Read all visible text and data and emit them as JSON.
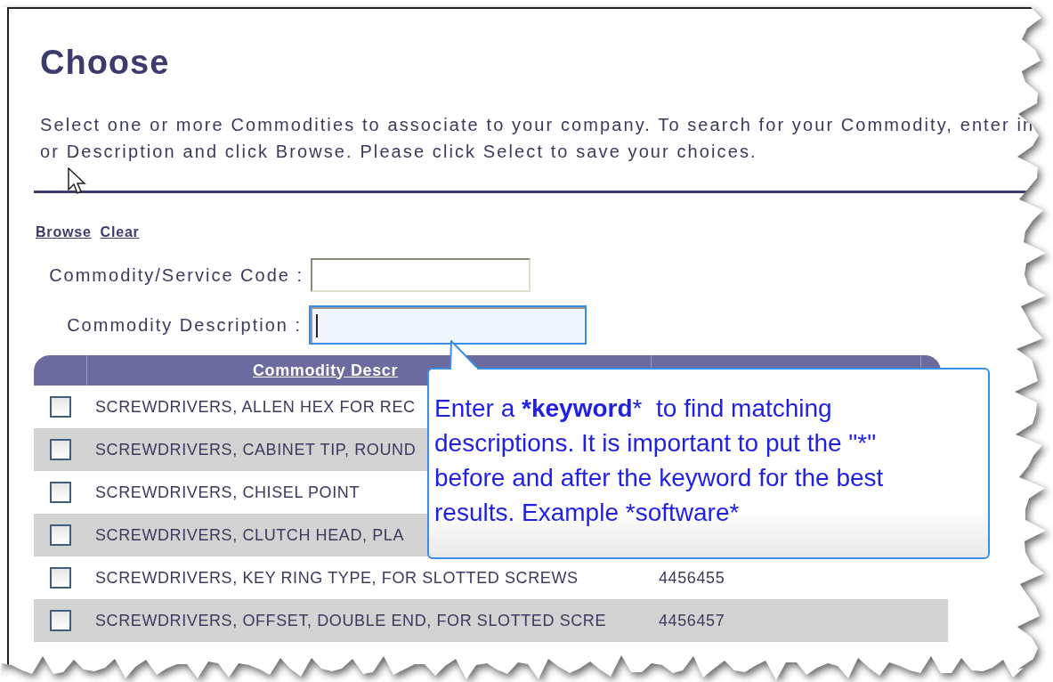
{
  "title": "Choose",
  "intro_lines": [
    "Select one or more Commodities to associate to your company. To search for your Commodity, enter in",
    "or Description and click Browse. Please click Select to save your choices."
  ],
  "links": [
    "Browse",
    "Clear"
  ],
  "fields": [
    {
      "label": "Commodity/Service Code :",
      "focused": false
    },
    {
      "label": "Commodity Description :",
      "focused": true
    }
  ],
  "table": {
    "columns": [
      "",
      "Commodity Descr",
      ""
    ],
    "rows": [
      {
        "checked": false,
        "description": "SCREWDRIVERS, ALLEN HEX FOR REC",
        "code": ""
      },
      {
        "checked": false,
        "description": "SCREWDRIVERS, CABINET TIP, ROUND",
        "code": ""
      },
      {
        "checked": false,
        "description": "SCREWDRIVERS, CHISEL POINT",
        "code": ""
      },
      {
        "checked": false,
        "description": "SCREWDRIVERS, CLUTCH HEAD, PLA",
        "code": ""
      },
      {
        "checked": false,
        "description": "SCREWDRIVERS, KEY RING TYPE, FOR SLOTTED SCREWS",
        "code": "4456455"
      },
      {
        "checked": false,
        "description": "SCREWDRIVERS, OFFSET, DOUBLE END, FOR SLOTTED SCRE",
        "code": "4456457"
      }
    ]
  },
  "callout": {
    "before": "Enter a ",
    "bold": "*keyword",
    "after": "*  to find matching descriptions. It is important to put the \"*\" before and after the keyword for the best results. Example *software*"
  }
}
